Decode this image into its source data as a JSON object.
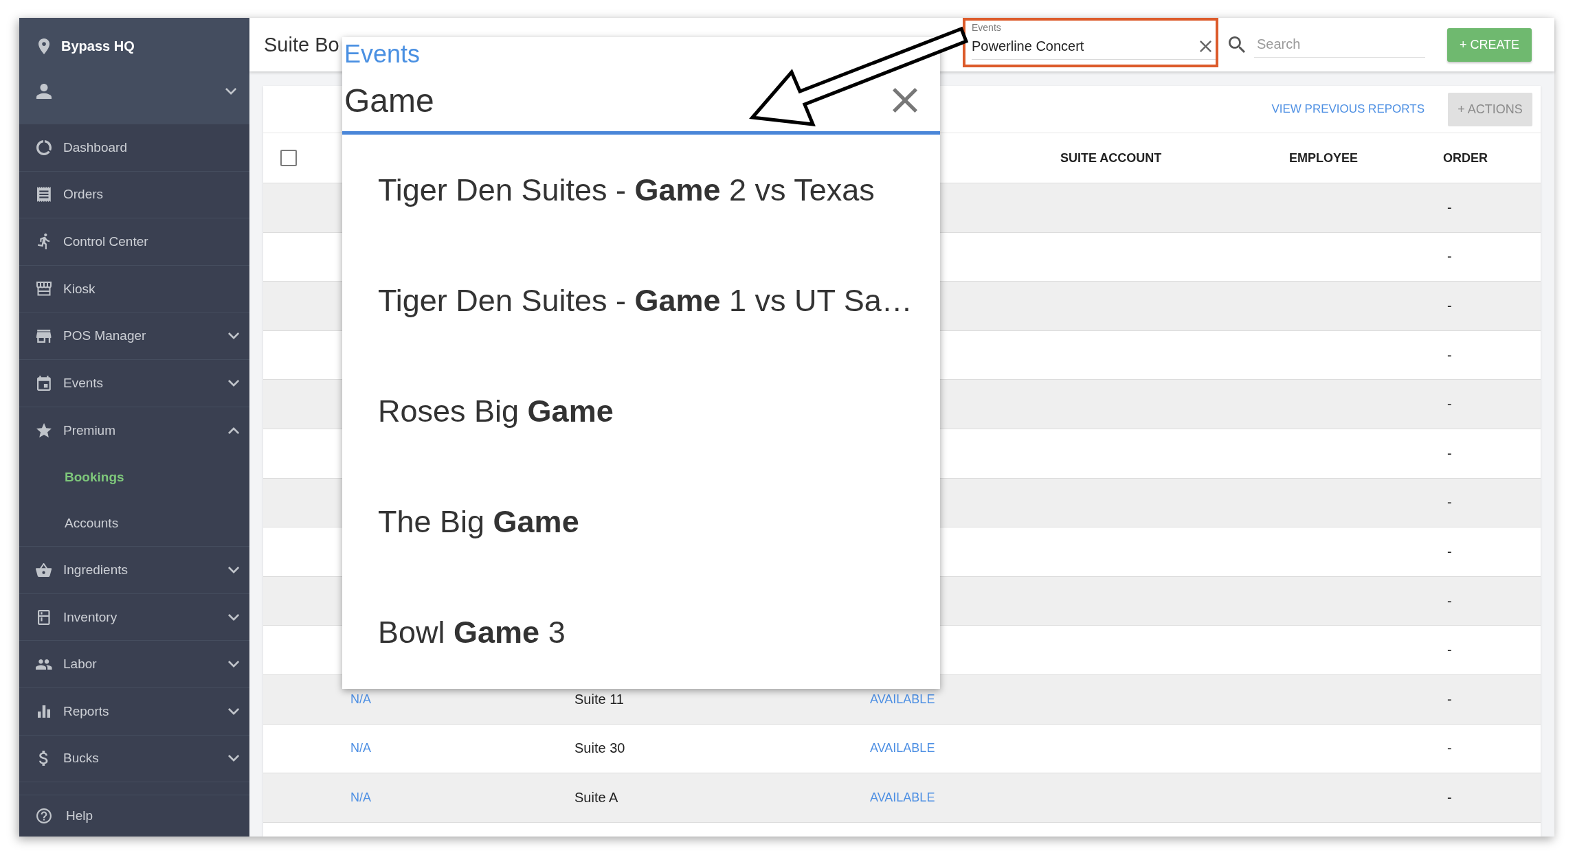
{
  "sidebar": {
    "venue": "Bypass HQ",
    "user_menu": {
      "expanded": false
    },
    "items": [
      {
        "label": "Dashboard",
        "kind": "link",
        "selected": false
      },
      {
        "label": "Orders",
        "kind": "link",
        "selected": false
      },
      {
        "label": "Control Center",
        "kind": "link",
        "selected": false
      },
      {
        "label": "Kiosk",
        "kind": "link",
        "selected": false
      },
      {
        "label": "POS Manager",
        "kind": "group",
        "expanded": false,
        "selected": false
      },
      {
        "label": "Events",
        "kind": "group",
        "expanded": false,
        "selected": false
      },
      {
        "label": "Premium",
        "kind": "group",
        "expanded": true,
        "selected": false,
        "children": [
          {
            "label": "Bookings",
            "selected": true
          },
          {
            "label": "Accounts",
            "selected": false
          }
        ]
      },
      {
        "label": "Ingredients",
        "kind": "group",
        "expanded": false,
        "selected": false
      },
      {
        "label": "Inventory",
        "kind": "group",
        "expanded": false,
        "selected": false
      },
      {
        "label": "Labor",
        "kind": "group",
        "expanded": false,
        "selected": false
      },
      {
        "label": "Reports",
        "kind": "group",
        "expanded": false,
        "selected": false
      },
      {
        "label": "Bucks",
        "kind": "group",
        "expanded": false,
        "selected": false
      }
    ],
    "help": "Help"
  },
  "top_bar": {
    "title": "Suite Bo",
    "events_filter": {
      "label": "Events",
      "value": "Powerline Concert",
      "highlighted": true
    },
    "search": {
      "placeholder": "Search"
    },
    "create_button": "+ CREATE"
  },
  "toolbar": {
    "link": "VIEW PREVIOUS REPORTS",
    "actions_button": "+ ACTIONS"
  },
  "table": {
    "select_all": {
      "checked": false
    },
    "columns": [
      "SUITE ACCOUNT",
      "EMPLOYEE",
      "ORDER"
    ],
    "rows": [
      {
        "order": "-"
      },
      {
        "order": "-"
      },
      {
        "order": "-"
      },
      {
        "order": "-"
      },
      {
        "order": "-"
      },
      {
        "order": "-"
      },
      {
        "order": "-"
      },
      {
        "order": "-"
      },
      {
        "order": "-"
      },
      {
        "order": "-"
      },
      {
        "column_1": "N/A",
        "column_2": "Suite 11",
        "column_3": "AVAILABLE",
        "order": "-"
      },
      {
        "column_1": "N/A",
        "column_2": "Suite 30",
        "column_3": "AVAILABLE",
        "order": "-"
      },
      {
        "column_1": "N/A",
        "column_2": "Suite A",
        "column_3": "AVAILABLE",
        "order": "-"
      }
    ]
  },
  "event_picker": {
    "label": "Events",
    "query": "Game",
    "options": [
      {
        "text": "Tiger Den Suites - **Game** 2 vs Texas",
        "selected": false
      },
      {
        "text": "Tiger Den Suites - **Game** 1 vs UT Sa…",
        "selected": false
      },
      {
        "text": "Roses Big **Game**",
        "selected": false
      },
      {
        "text": "The Big **Game**",
        "selected": false
      },
      {
        "text": "Bowl **Game** 3",
        "selected": false
      }
    ]
  },
  "annotations": [
    {
      "kind": "arrow"
    }
  ]
}
